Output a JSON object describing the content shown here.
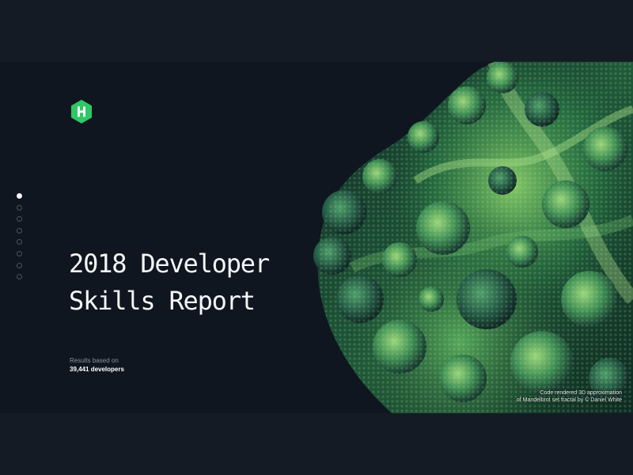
{
  "brand": {
    "logo_letter": "H",
    "logo_color": "#2ec866",
    "icon": "hackerrank-logo-icon"
  },
  "pagination": {
    "total": 8,
    "active_index": 0
  },
  "hero": {
    "title_line1": "2018 Developer",
    "title_line2": "Skills Report"
  },
  "stats": {
    "label": "Results based on",
    "value": "39,441 developers"
  },
  "artwork": {
    "caption_line1": "Code rendered 3D approximation",
    "caption_line2": "of Mandelbrot set fractal by © Daniel White"
  },
  "colors": {
    "page_background": "#141b25",
    "slide_background": "#0f1620",
    "text_primary": "#f4f6f8",
    "text_muted": "#8a929c",
    "fractal_dark": "#0f3a2e",
    "fractal_light": "#7fcf6a"
  }
}
